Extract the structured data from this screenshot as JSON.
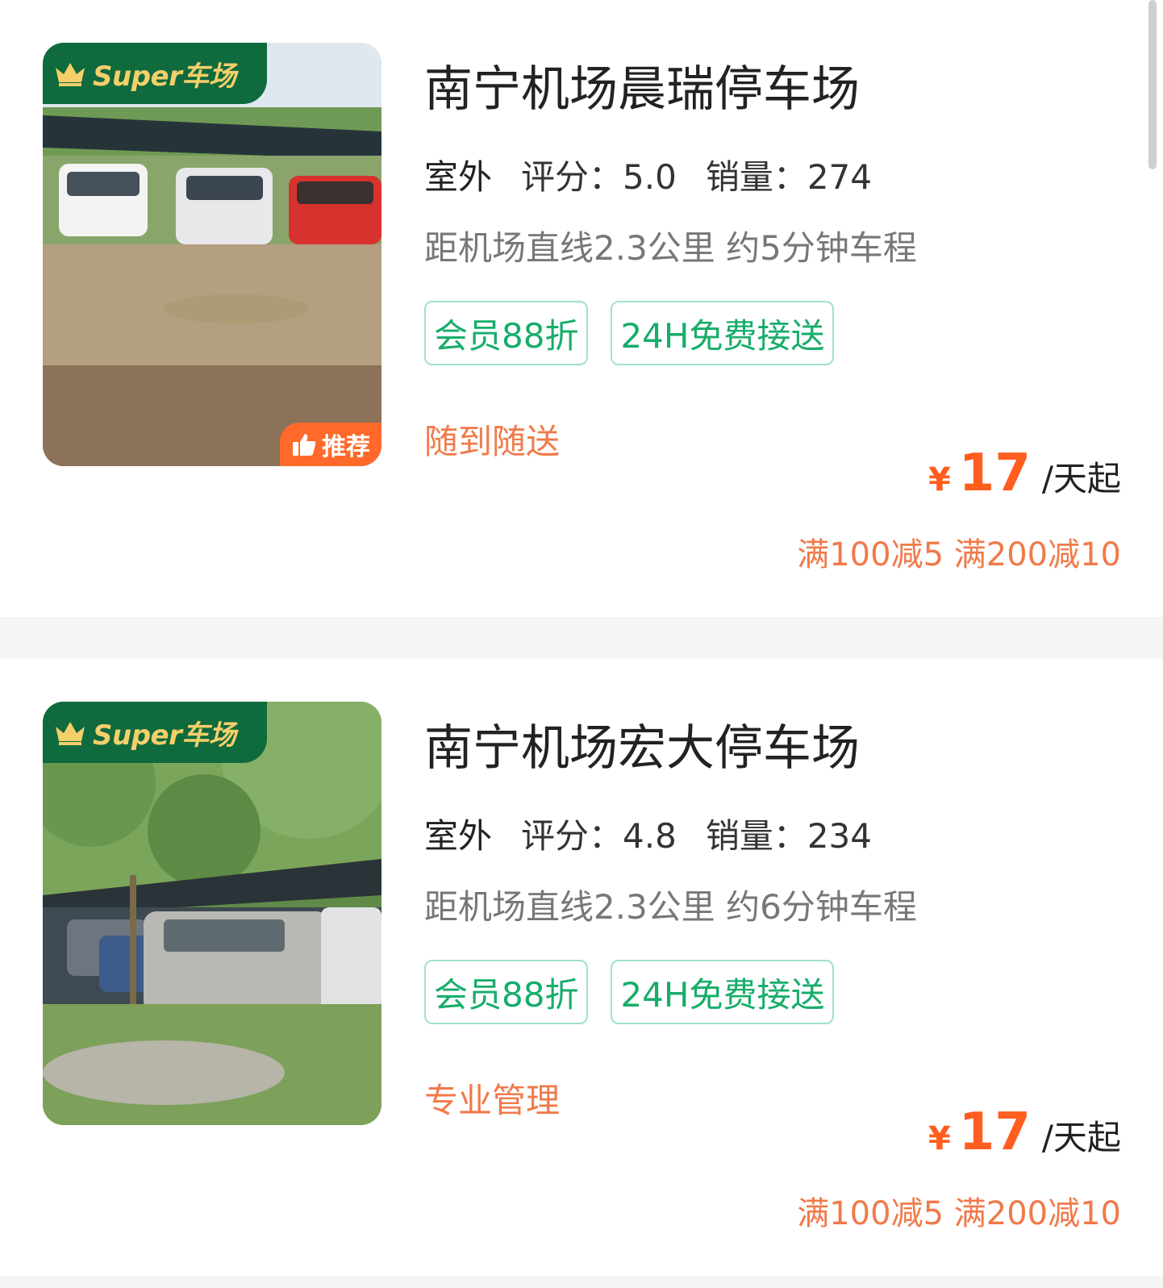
{
  "lots": [
    {
      "badge": "Super车场",
      "recommend": "推荐",
      "name": "南宁机场晨瑞停车场",
      "type": "室外",
      "rating": "评分：5.0",
      "sales": "销量：274",
      "distance": "距机场直线2.3公里 约5分钟车程",
      "tags": [
        "会员88折",
        "24H免费接送"
      ],
      "feature": "随到随送",
      "currency": "¥",
      "price": "17",
      "price_unit": "/天起",
      "promo": "满100减5 满200减10"
    },
    {
      "badge": "Super车场",
      "name": "南宁机场宏大停车场",
      "type": "室外",
      "rating": "评分：4.8",
      "sales": "销量：234",
      "distance": "距机场直线2.3公里 约6分钟车程",
      "tags": [
        "会员88折",
        "24H免费接送"
      ],
      "feature": "专业管理",
      "currency": "¥",
      "price": "17",
      "price_unit": "/天起",
      "promo": "满100减5 满200减10"
    }
  ],
  "colors": {
    "brand_green": "#0f6a3d",
    "tag_green": "#17ad6a",
    "price_orange": "#ff5e1f",
    "promo_orange": "#f07a4a"
  }
}
